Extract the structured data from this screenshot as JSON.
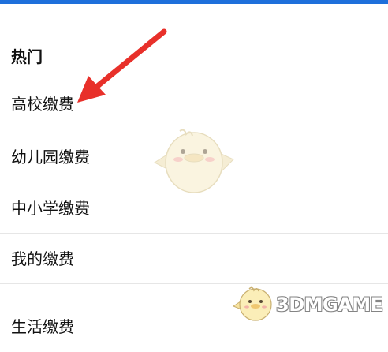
{
  "section_header": "热门",
  "menu_items": [
    {
      "label": "高校缴费"
    },
    {
      "label": "幼儿园缴费"
    },
    {
      "label": "中小学缴费"
    },
    {
      "label": "我的缴费"
    },
    {
      "label": "生活缴费"
    }
  ],
  "watermark_text": "3DMGAME",
  "colors": {
    "top_bar": "#1e6fdb",
    "arrow": "#e8302a",
    "divider": "#e6e6e6"
  },
  "icons": {
    "annotation": "red-arrow-icon",
    "mascot": "chick-mascot-icon",
    "watermark": "chick-watermark-icon"
  }
}
